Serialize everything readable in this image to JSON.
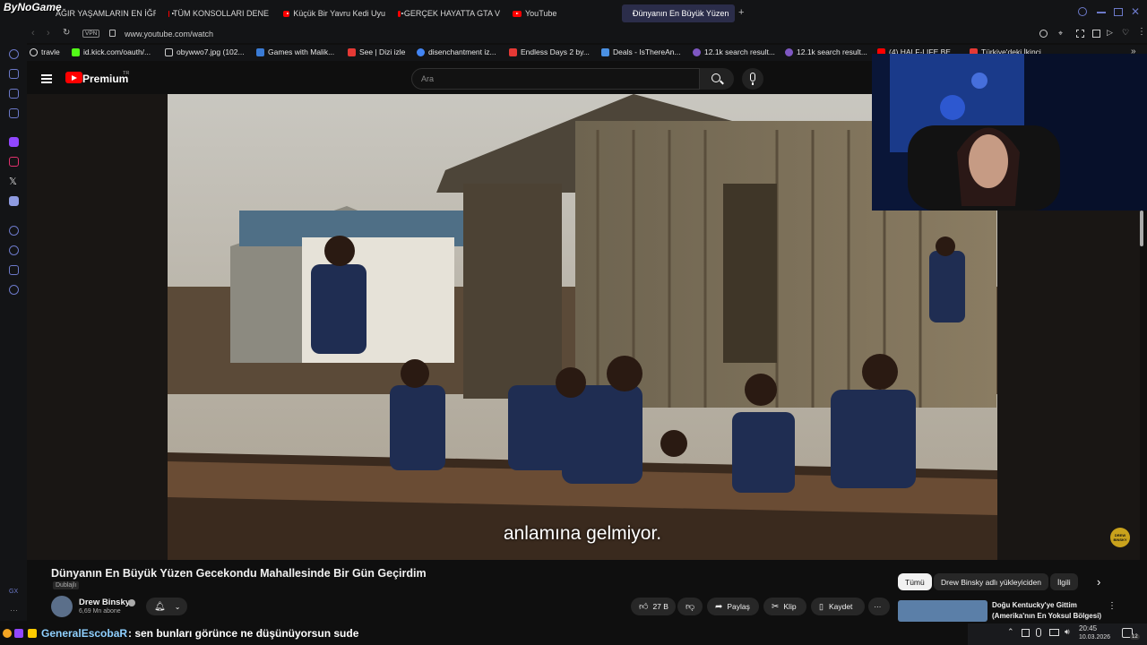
{
  "watermark": "ByNoGame",
  "tabs": [
    {
      "label": "AĞIR YAŞAMLARIN EN İĞR",
      "icon": "youtube-icon"
    },
    {
      "label": "TÜM KONSOLLARI DENE",
      "icon": "youtube-icon"
    },
    {
      "label": "Küçük Bir Yavru Kedi Uyu",
      "icon": "youtube-icon"
    },
    {
      "label": "GERÇEK HAYATTA GTA V",
      "icon": "youtube-icon"
    },
    {
      "label": "YouTube",
      "icon": "youtube-icon"
    },
    {
      "label": "Dünyanın En Büyük Yüzen",
      "icon": "youtube-icon",
      "active": true
    }
  ],
  "address": {
    "vpn": "VPN",
    "url": "www.youtube.com/watch"
  },
  "bookmarks": [
    {
      "label": "travle",
      "color": "#e8e8e8"
    },
    {
      "label": "id.kick.com/oauth/...",
      "color": "#53fc18"
    },
    {
      "label": "obywwo7.jpg (102...",
      "color": "#cccccc"
    },
    {
      "label": "Games with Malik...",
      "color": "#3a7bd5"
    },
    {
      "label": "See | Dizi izle",
      "color": "#e53935"
    },
    {
      "label": "disenchantment iz...",
      "color": "#4285f4"
    },
    {
      "label": "Endless Days 2 by...",
      "color": "#e53935"
    },
    {
      "label": "Deals - IsThereAn...",
      "color": "#4a90e2"
    },
    {
      "label": "12.1k search result...",
      "color": "#7e57c2"
    },
    {
      "label": "12.1k search result...",
      "color": "#7e57c2"
    },
    {
      "label": "(4) HALF-LIFE BE...",
      "color": "#ff0000"
    },
    {
      "label": "Türkiye'deki İkinci...",
      "color": "#e53935"
    }
  ],
  "youtube": {
    "logo": "Premium",
    "region": "TR",
    "search_placeholder": "Ara"
  },
  "video": {
    "caption": "anlamına gelmiyor.",
    "title": "Dünyanın En Büyük Yüzen Gecekondu Mahallesinde Bir Gün Geçirdim",
    "dub_badge": "Dublajlı",
    "channel": "Drew Binsky",
    "subscribers": "6,69 Mn abone",
    "likes": "27 B",
    "share": "Paylaş",
    "clip": "Klip",
    "save": "Kaydet",
    "channel_watermark": "DREW BINSKY"
  },
  "chips": [
    "Tümü",
    "Drew Binsky adlı yükleyiciden",
    "İlgili"
  ],
  "recommended": {
    "title_line1": "Doğu Kentucky'ye Gittim",
    "title_line2": "(Amerika'nın En Yoksul Bölgesi)"
  },
  "chat": {
    "user": "GeneralEscobaR",
    "message": ": sen bunları görünce ne düşünüyorsun sude"
  },
  "taskbar": {
    "time": "20:45",
    "date": "10.03.2026",
    "notifications": "12"
  },
  "sidebar_gx": "GX",
  "colors": {
    "accent": "#ff0000",
    "sidebar_icon": "#6c79c9",
    "chat_user": "#8fd0ff"
  }
}
